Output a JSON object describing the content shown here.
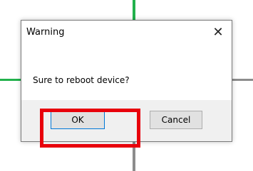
{
  "dialog": {
    "title": "Warning",
    "close_glyph": "✕",
    "close_icon": "close-icon",
    "message": "Sure to reboot device?",
    "buttons": {
      "ok_label": "OK",
      "cancel_label": "Cancel"
    }
  },
  "colors": {
    "highlight": "#e8000b",
    "grid_green": "#22b14c",
    "grid_gray": "#8c8c8c",
    "button_focus": "#0078d7"
  }
}
